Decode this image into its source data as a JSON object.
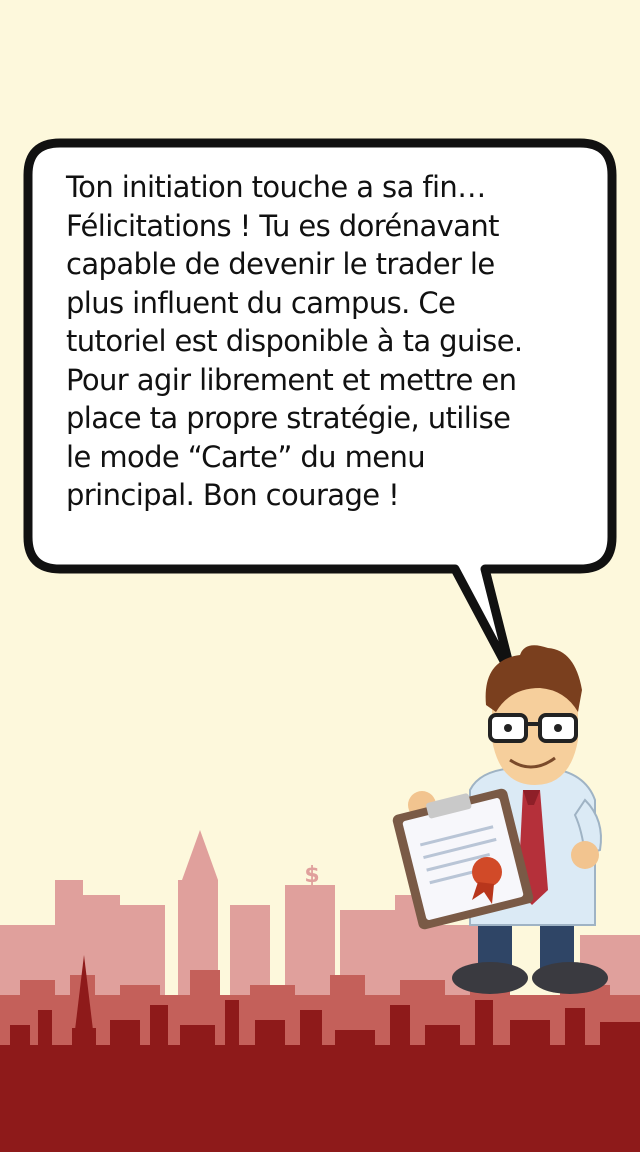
{
  "dialog": {
    "lines": [
      "Ton initiation touche a sa fin…",
      "Félicitations ! Tu es dorénavant",
      "capable de devenir le trader le",
      "plus influent du campus. Ce",
      "tutoriel est disponible à ta guise.",
      "Pour agir librement et mettre en",
      "place ta propre stratégie, utilise",
      "le mode “Carte” du menu",
      "principal. Bon courage !"
    ]
  },
  "scene": {
    "background_color": "#fdf8dc",
    "skyline_back_color": "#d98a88",
    "skyline_mid_color": "#c15a52",
    "skyline_front_color": "#8e1a1a",
    "building_sign": "$"
  },
  "character": {
    "name": "trader-mentor",
    "holding": "clipboard-with-certificate-icon"
  }
}
